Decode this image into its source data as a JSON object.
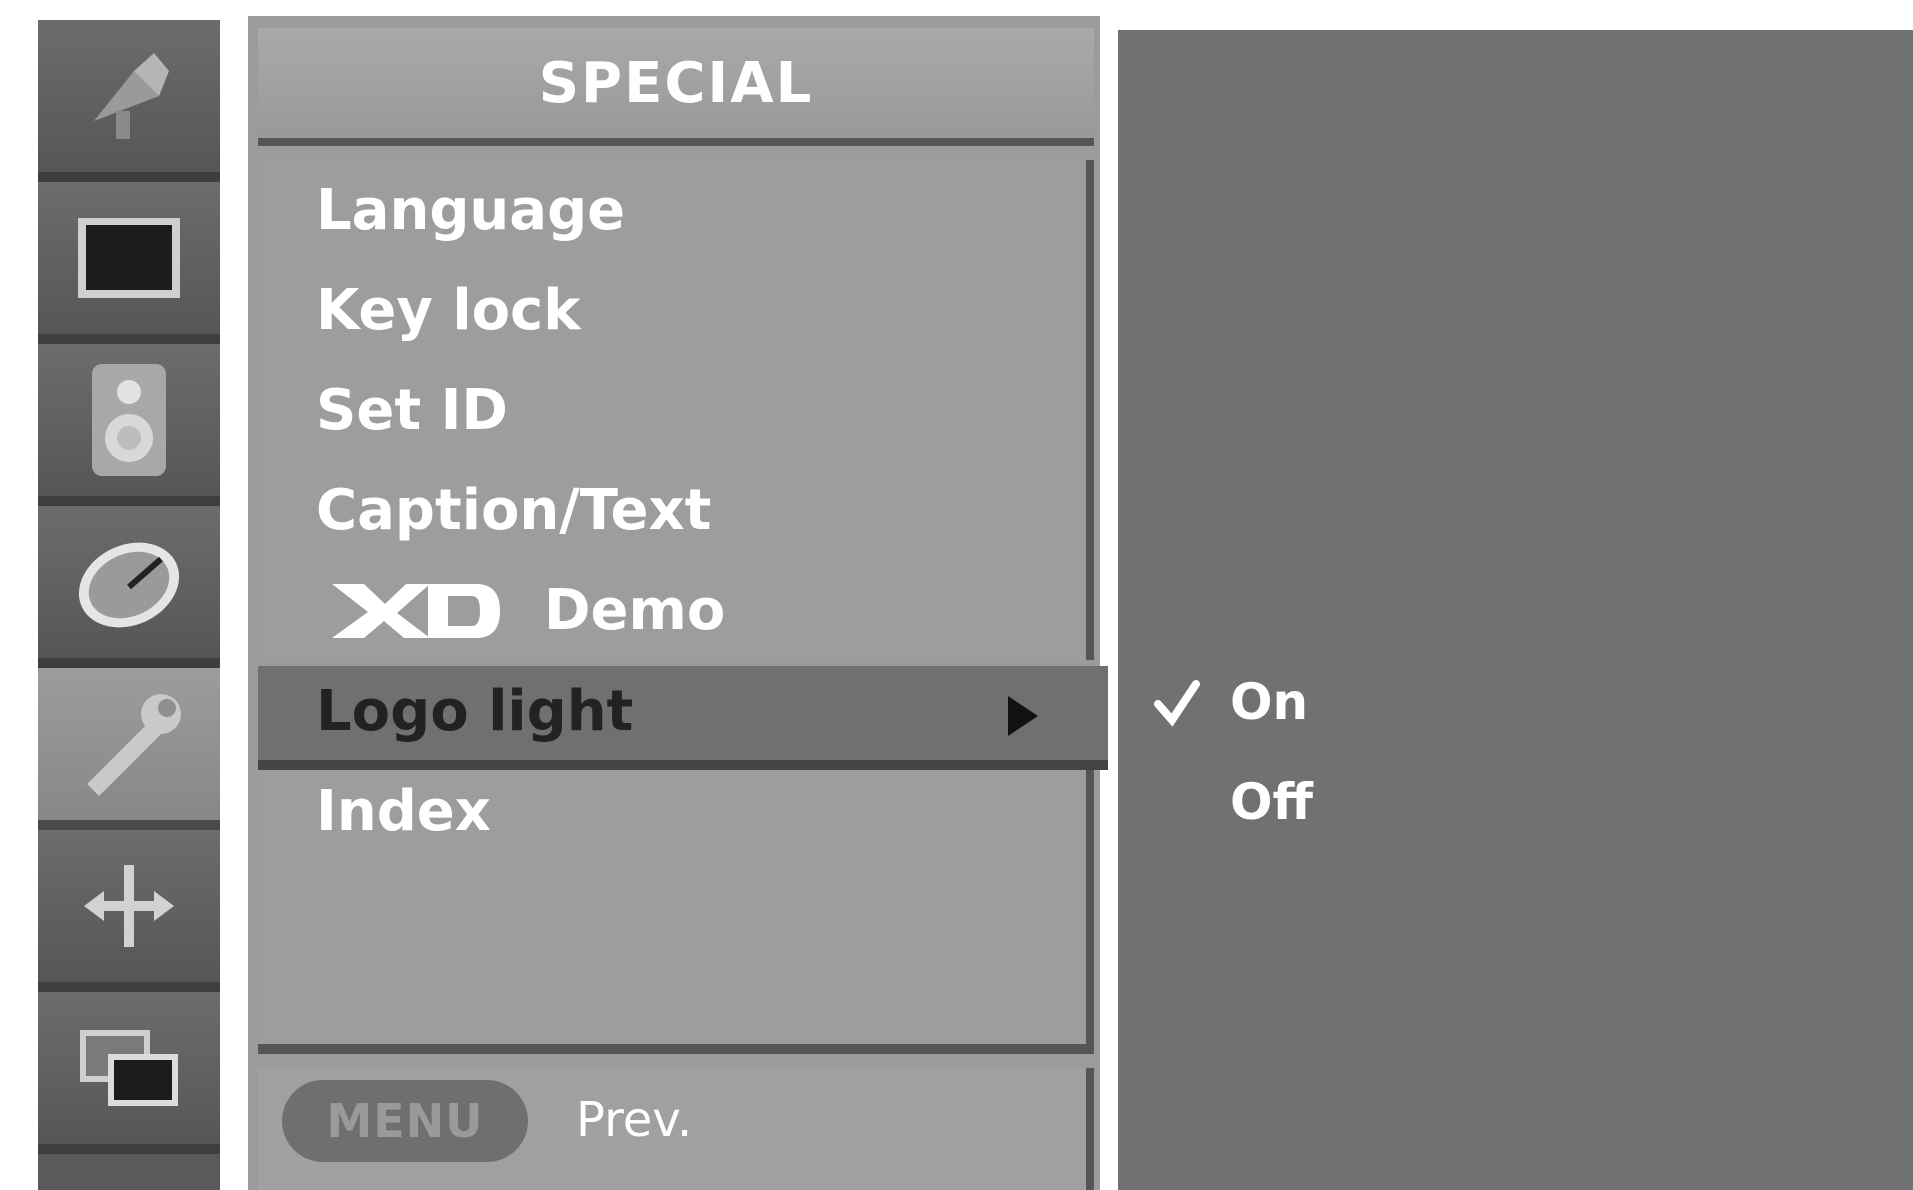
{
  "rail": {
    "items": [
      {
        "icon": "satellite-dish-icon",
        "selected": false
      },
      {
        "icon": "screen-icon",
        "selected": false
      },
      {
        "icon": "speaker-icon",
        "selected": false
      },
      {
        "icon": "clock-icon",
        "selected": false
      },
      {
        "icon": "wrench-icon",
        "selected": true
      },
      {
        "icon": "move-arrows-icon",
        "selected": false
      },
      {
        "icon": "pip-windows-icon",
        "selected": false
      }
    ]
  },
  "menu": {
    "title": "SPECIAL",
    "items": [
      {
        "label": "Language"
      },
      {
        "label": "Key lock"
      },
      {
        "label": "Set ID"
      },
      {
        "label": "Caption/Text"
      },
      {
        "logo": "XD",
        "label": "Demo"
      },
      {
        "label": "Logo light",
        "selected": true
      },
      {
        "label": "Index"
      }
    ]
  },
  "submenu": {
    "options": [
      {
        "label": "On",
        "checked": true
      },
      {
        "label": "Off",
        "checked": false
      }
    ]
  },
  "footer": {
    "menu_button": "MENU",
    "prev_label": "Prev."
  }
}
